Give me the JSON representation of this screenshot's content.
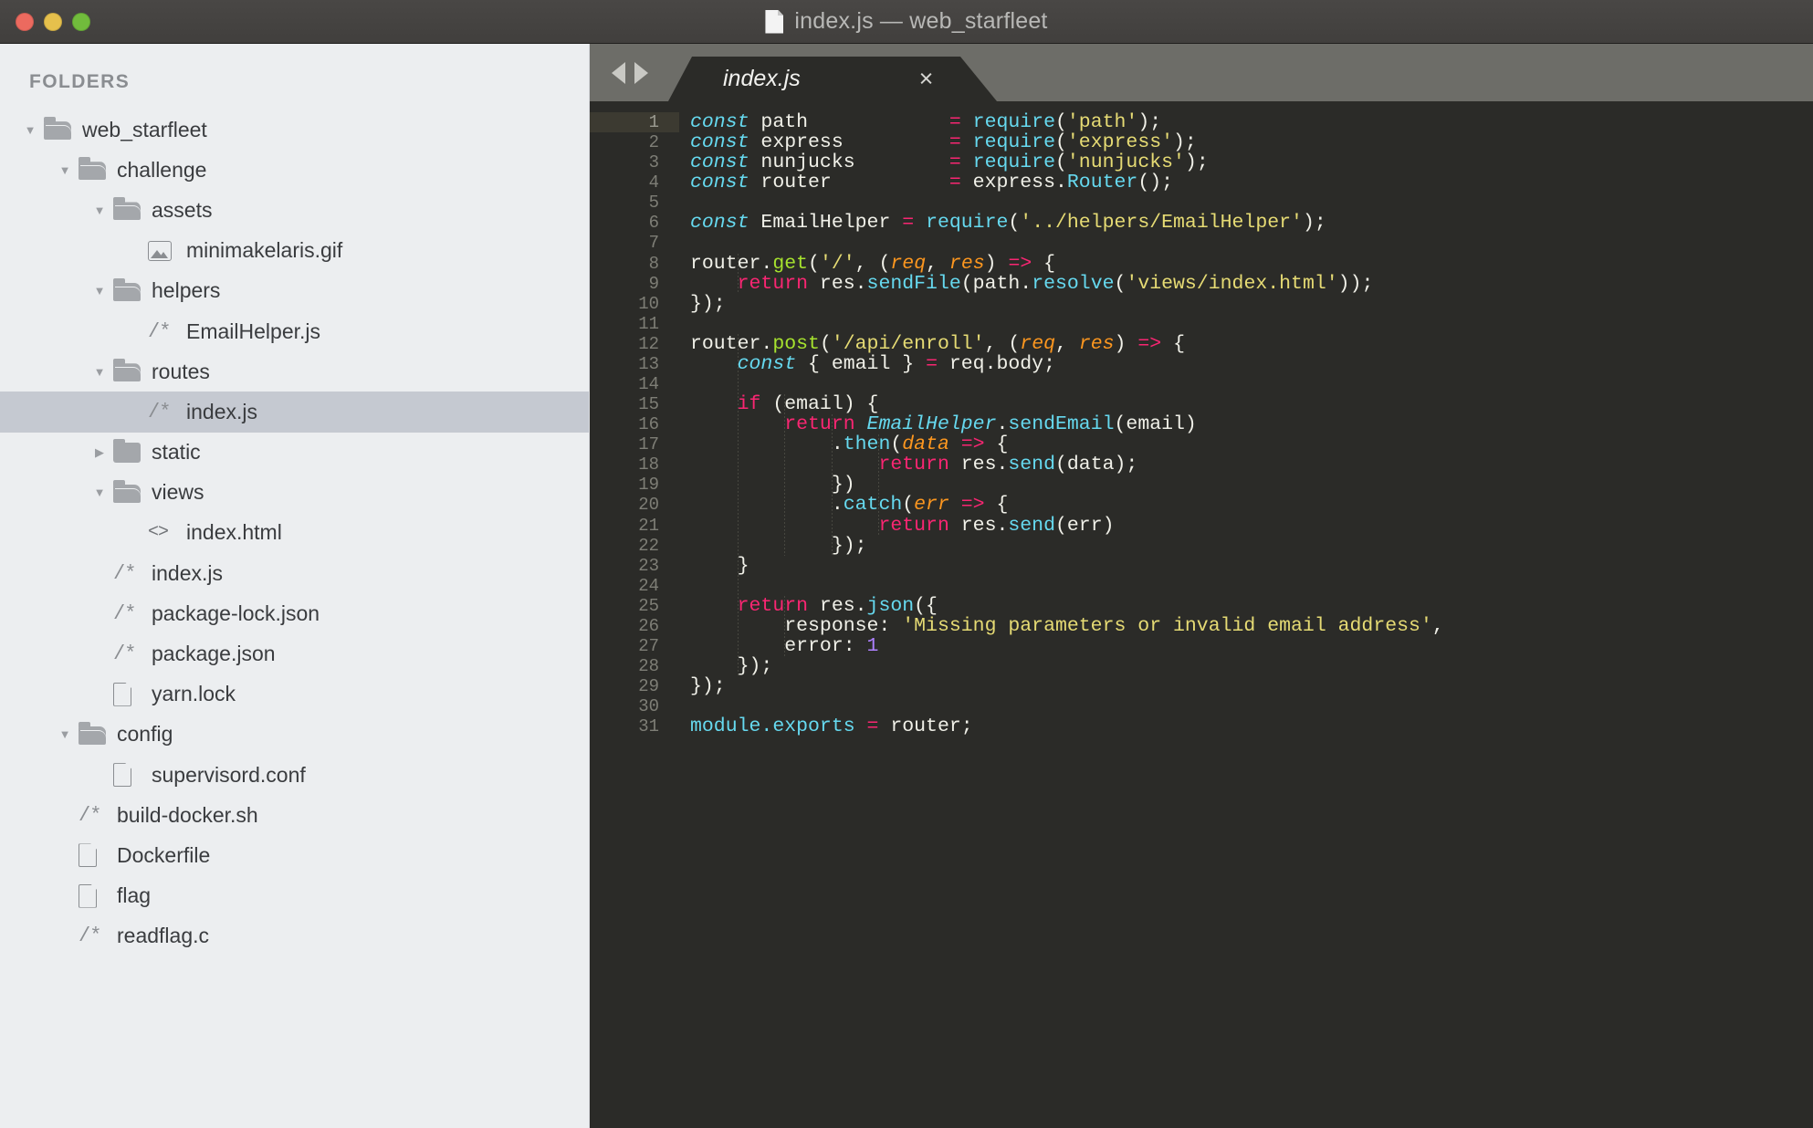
{
  "window": {
    "title": "index.js — web_starfleet",
    "title_icon": "document-icon",
    "traffic_lights": [
      {
        "name": "close-button",
        "color": "#ec6a5f"
      },
      {
        "name": "minimize-button",
        "color": "#e6c04c"
      },
      {
        "name": "zoom-button",
        "color": "#71bc3c"
      }
    ]
  },
  "sidebar": {
    "header": "FOLDERS",
    "items": [
      {
        "label": "web_starfleet",
        "indent": 0,
        "icon": "folder-open-icon",
        "twisty": "down",
        "selected": false
      },
      {
        "label": "challenge",
        "indent": 1,
        "icon": "folder-open-icon",
        "twisty": "down",
        "selected": false
      },
      {
        "label": "assets",
        "indent": 2,
        "icon": "folder-open-icon",
        "twisty": "down",
        "selected": false
      },
      {
        "label": "minimakelaris.gif",
        "indent": 3,
        "icon": "image-file-icon",
        "twisty": "none",
        "selected": false
      },
      {
        "label": "helpers",
        "indent": 2,
        "icon": "folder-open-icon",
        "twisty": "down",
        "selected": false
      },
      {
        "label": "EmailHelper.js",
        "indent": 3,
        "icon": "comment-file-icon",
        "twisty": "none",
        "selected": false
      },
      {
        "label": "routes",
        "indent": 2,
        "icon": "folder-open-icon",
        "twisty": "down",
        "selected": false
      },
      {
        "label": "index.js",
        "indent": 3,
        "icon": "comment-file-icon",
        "twisty": "none",
        "selected": true
      },
      {
        "label": "static",
        "indent": 2,
        "icon": "folder-closed-icon",
        "twisty": "right",
        "selected": false
      },
      {
        "label": "views",
        "indent": 2,
        "icon": "folder-open-icon",
        "twisty": "down",
        "selected": false
      },
      {
        "label": "index.html",
        "indent": 3,
        "icon": "html-file-icon",
        "twisty": "none",
        "selected": false
      },
      {
        "label": "index.js",
        "indent": 2,
        "icon": "comment-file-icon",
        "twisty": "none",
        "selected": false
      },
      {
        "label": "package-lock.json",
        "indent": 2,
        "icon": "comment-file-icon",
        "twisty": "none",
        "selected": false
      },
      {
        "label": "package.json",
        "indent": 2,
        "icon": "comment-file-icon",
        "twisty": "none",
        "selected": false
      },
      {
        "label": "yarn.lock",
        "indent": 2,
        "icon": "plain-file-icon",
        "twisty": "none",
        "selected": false
      },
      {
        "label": "config",
        "indent": 1,
        "icon": "folder-open-icon",
        "twisty": "down",
        "selected": false
      },
      {
        "label": "supervisord.conf",
        "indent": 2,
        "icon": "plain-file-icon",
        "twisty": "none",
        "selected": false
      },
      {
        "label": "build-docker.sh",
        "indent": 1,
        "icon": "comment-file-icon",
        "twisty": "none",
        "selected": false
      },
      {
        "label": "Dockerfile",
        "indent": 1,
        "icon": "plain-file-icon",
        "twisty": "none",
        "selected": false
      },
      {
        "label": "flag",
        "indent": 1,
        "icon": "plain-file-icon",
        "twisty": "none",
        "selected": false
      },
      {
        "label": "readflag.c",
        "indent": 1,
        "icon": "comment-file-icon",
        "twisty": "none",
        "selected": false
      }
    ]
  },
  "editor": {
    "nav_back": "◀",
    "nav_forward": "▶",
    "tabs": [
      {
        "label": "index.js",
        "close": "×",
        "active": true,
        "modified_italic": true
      }
    ],
    "active_line": 1,
    "line_count": 31,
    "lines": [
      {
        "n": 1,
        "tokens": [
          {
            "t": "const",
            "c": "kwi"
          },
          {
            "t": " path            ",
            "c": "pl"
          },
          {
            "t": "=",
            "c": "kw"
          },
          {
            "t": " ",
            "c": "pl"
          },
          {
            "t": "require",
            "c": "fn"
          },
          {
            "t": "(",
            "c": "pl"
          },
          {
            "t": "'path'",
            "c": "str"
          },
          {
            "t": ");",
            "c": "pl"
          }
        ]
      },
      {
        "n": 2,
        "tokens": [
          {
            "t": "const",
            "c": "kwi"
          },
          {
            "t": " express         ",
            "c": "pl"
          },
          {
            "t": "=",
            "c": "kw"
          },
          {
            "t": " ",
            "c": "pl"
          },
          {
            "t": "require",
            "c": "fn"
          },
          {
            "t": "(",
            "c": "pl"
          },
          {
            "t": "'express'",
            "c": "str"
          },
          {
            "t": ");",
            "c": "pl"
          }
        ]
      },
      {
        "n": 3,
        "tokens": [
          {
            "t": "const",
            "c": "kwi"
          },
          {
            "t": " nunjucks        ",
            "c": "pl"
          },
          {
            "t": "=",
            "c": "kw"
          },
          {
            "t": " ",
            "c": "pl"
          },
          {
            "t": "require",
            "c": "fn"
          },
          {
            "t": "(",
            "c": "pl"
          },
          {
            "t": "'nunjucks'",
            "c": "str"
          },
          {
            "t": ");",
            "c": "pl"
          }
        ]
      },
      {
        "n": 4,
        "tokens": [
          {
            "t": "const",
            "c": "kwi"
          },
          {
            "t": " router          ",
            "c": "pl"
          },
          {
            "t": "=",
            "c": "kw"
          },
          {
            "t": " express.",
            "c": "pl"
          },
          {
            "t": "Router",
            "c": "fn"
          },
          {
            "t": "();",
            "c": "pl"
          }
        ]
      },
      {
        "n": 5,
        "tokens": []
      },
      {
        "n": 6,
        "tokens": [
          {
            "t": "const",
            "c": "kwi"
          },
          {
            "t": " EmailHelper ",
            "c": "pl"
          },
          {
            "t": "=",
            "c": "kw"
          },
          {
            "t": " ",
            "c": "pl"
          },
          {
            "t": "require",
            "c": "fn"
          },
          {
            "t": "(",
            "c": "pl"
          },
          {
            "t": "'../helpers/EmailHelper'",
            "c": "str"
          },
          {
            "t": ");",
            "c": "pl"
          }
        ]
      },
      {
        "n": 7,
        "tokens": []
      },
      {
        "n": 8,
        "tokens": [
          {
            "t": "router.",
            "c": "pl"
          },
          {
            "t": "get",
            "c": "fng"
          },
          {
            "t": "(",
            "c": "pl"
          },
          {
            "t": "'/'",
            "c": "str"
          },
          {
            "t": ", (",
            "c": "pl"
          },
          {
            "t": "req",
            "c": "par"
          },
          {
            "t": ", ",
            "c": "pl"
          },
          {
            "t": "res",
            "c": "par"
          },
          {
            "t": ") ",
            "c": "pl"
          },
          {
            "t": "=>",
            "c": "kw"
          },
          {
            "t": " {",
            "c": "pl"
          }
        ]
      },
      {
        "n": 9,
        "tokens": [
          {
            "t": "    ",
            "c": "pl"
          },
          {
            "t": "return",
            "c": "kw"
          },
          {
            "t": " res.",
            "c": "pl"
          },
          {
            "t": "sendFile",
            "c": "fn"
          },
          {
            "t": "(path.",
            "c": "pl"
          },
          {
            "t": "resolve",
            "c": "fn"
          },
          {
            "t": "(",
            "c": "pl"
          },
          {
            "t": "'views/index.html'",
            "c": "str"
          },
          {
            "t": "));",
            "c": "pl"
          }
        ]
      },
      {
        "n": 10,
        "tokens": [
          {
            "t": "});",
            "c": "pl"
          }
        ]
      },
      {
        "n": 11,
        "tokens": []
      },
      {
        "n": 12,
        "tokens": [
          {
            "t": "router.",
            "c": "pl"
          },
          {
            "t": "post",
            "c": "fng"
          },
          {
            "t": "(",
            "c": "pl"
          },
          {
            "t": "'/api/enroll'",
            "c": "str"
          },
          {
            "t": ", (",
            "c": "pl"
          },
          {
            "t": "req",
            "c": "par"
          },
          {
            "t": ", ",
            "c": "pl"
          },
          {
            "t": "res",
            "c": "par"
          },
          {
            "t": ") ",
            "c": "pl"
          },
          {
            "t": "=>",
            "c": "kw"
          },
          {
            "t": " {",
            "c": "pl"
          }
        ]
      },
      {
        "n": 13,
        "tokens": [
          {
            "t": "    ",
            "c": "pl"
          },
          {
            "t": "const",
            "c": "kwi"
          },
          {
            "t": " { email } ",
            "c": "pl"
          },
          {
            "t": "=",
            "c": "kw"
          },
          {
            "t": " req.body;",
            "c": "pl"
          }
        ]
      },
      {
        "n": 14,
        "tokens": []
      },
      {
        "n": 15,
        "tokens": [
          {
            "t": "    ",
            "c": "pl"
          },
          {
            "t": "if",
            "c": "kw"
          },
          {
            "t": " (email) {",
            "c": "pl"
          }
        ]
      },
      {
        "n": 16,
        "tokens": [
          {
            "t": "        ",
            "c": "pl"
          },
          {
            "t": "return",
            "c": "kw"
          },
          {
            "t": " ",
            "c": "pl"
          },
          {
            "t": "EmailHelper",
            "c": "cls"
          },
          {
            "t": ".",
            "c": "pl"
          },
          {
            "t": "sendEmail",
            "c": "fn"
          },
          {
            "t": "(email)",
            "c": "pl"
          }
        ]
      },
      {
        "n": 17,
        "tokens": [
          {
            "t": "            .",
            "c": "pl"
          },
          {
            "t": "then",
            "c": "fn"
          },
          {
            "t": "(",
            "c": "pl"
          },
          {
            "t": "data",
            "c": "par"
          },
          {
            "t": " ",
            "c": "pl"
          },
          {
            "t": "=>",
            "c": "kw"
          },
          {
            "t": " {",
            "c": "pl"
          }
        ]
      },
      {
        "n": 18,
        "tokens": [
          {
            "t": "                ",
            "c": "pl"
          },
          {
            "t": "return",
            "c": "kw"
          },
          {
            "t": " res.",
            "c": "pl"
          },
          {
            "t": "send",
            "c": "fn"
          },
          {
            "t": "(data);",
            "c": "pl"
          }
        ]
      },
      {
        "n": 19,
        "tokens": [
          {
            "t": "            })",
            "c": "pl"
          }
        ]
      },
      {
        "n": 20,
        "tokens": [
          {
            "t": "            .",
            "c": "pl"
          },
          {
            "t": "catch",
            "c": "fn"
          },
          {
            "t": "(",
            "c": "pl"
          },
          {
            "t": "err",
            "c": "par"
          },
          {
            "t": " ",
            "c": "pl"
          },
          {
            "t": "=>",
            "c": "kw"
          },
          {
            "t": " {",
            "c": "pl"
          }
        ]
      },
      {
        "n": 21,
        "tokens": [
          {
            "t": "                ",
            "c": "pl"
          },
          {
            "t": "return",
            "c": "kw"
          },
          {
            "t": " res.",
            "c": "pl"
          },
          {
            "t": "send",
            "c": "fn"
          },
          {
            "t": "(err)",
            "c": "pl"
          }
        ]
      },
      {
        "n": 22,
        "tokens": [
          {
            "t": "            });",
            "c": "pl"
          }
        ]
      },
      {
        "n": 23,
        "tokens": [
          {
            "t": "    }",
            "c": "pl"
          }
        ]
      },
      {
        "n": 24,
        "tokens": []
      },
      {
        "n": 25,
        "tokens": [
          {
            "t": "    ",
            "c": "pl"
          },
          {
            "t": "return",
            "c": "kw"
          },
          {
            "t": " res.",
            "c": "pl"
          },
          {
            "t": "json",
            "c": "fn"
          },
          {
            "t": "({",
            "c": "pl"
          }
        ]
      },
      {
        "n": 26,
        "tokens": [
          {
            "t": "        response: ",
            "c": "pl"
          },
          {
            "t": "'Missing parameters or invalid email address'",
            "c": "str"
          },
          {
            "t": ",",
            "c": "pl"
          }
        ]
      },
      {
        "n": 27,
        "tokens": [
          {
            "t": "        error: ",
            "c": "pl"
          },
          {
            "t": "1",
            "c": "num"
          }
        ]
      },
      {
        "n": 28,
        "tokens": [
          {
            "t": "    });",
            "c": "pl"
          }
        ]
      },
      {
        "n": 29,
        "tokens": [
          {
            "t": "});",
            "c": "pl"
          }
        ]
      },
      {
        "n": 30,
        "tokens": []
      },
      {
        "n": 31,
        "tokens": [
          {
            "t": "module.exports",
            "c": "fn"
          },
          {
            "t": " ",
            "c": "pl"
          },
          {
            "t": "=",
            "c": "kw"
          },
          {
            "t": " router;",
            "c": "pl"
          }
        ]
      }
    ]
  },
  "theme": {
    "editor_bg": "#2b2b28",
    "sidebar_bg": "#eceef0",
    "titlebar_bg": "#434240",
    "tabbar_bg": "#6d6d68",
    "selection_bg": "#c5c9d1",
    "keyword": "#f92672",
    "function": "#66d9ef",
    "green_fn": "#a6e22e",
    "string": "#e6db74",
    "number": "#ae81ff",
    "param": "#fd971f",
    "plain": "#f0f0e8",
    "line_number": "#7e7e76"
  }
}
